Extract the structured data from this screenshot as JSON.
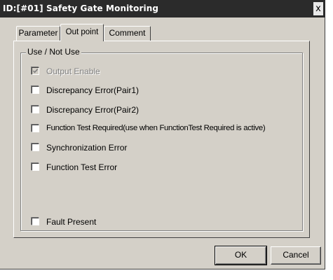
{
  "window": {
    "title": "ID:[#01]  Safety Gate Monitoring",
    "close_glyph": "x"
  },
  "tabs": [
    {
      "label": "Parameter",
      "active": false
    },
    {
      "label": "Out point",
      "active": true
    },
    {
      "label": "Comment",
      "active": false
    }
  ],
  "group": {
    "title": "Use / Not Use",
    "items": [
      {
        "label": "Output Enable",
        "checked": true,
        "enabled": false
      },
      {
        "label": "Discrepancy Error(Pair1)",
        "checked": false,
        "enabled": true
      },
      {
        "label": "Discrepancy Error(Pair2)",
        "checked": false,
        "enabled": true
      },
      {
        "label": "Function Test Required(use when FunctionTest Required is active)",
        "checked": false,
        "enabled": true
      },
      {
        "label": "Synchronization Error",
        "checked": false,
        "enabled": true
      },
      {
        "label": "Function Test Error",
        "checked": false,
        "enabled": true
      },
      {
        "label": "Fault Present",
        "checked": false,
        "enabled": true
      }
    ]
  },
  "buttons": {
    "ok": "OK",
    "cancel": "Cancel"
  }
}
